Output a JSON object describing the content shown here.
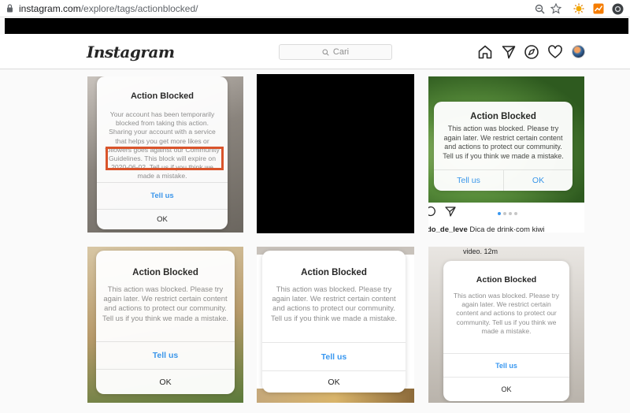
{
  "browser": {
    "url_host": "instagram.com",
    "url_path": "/explore/tags/actionblocked/"
  },
  "header": {
    "logo": "Instagram",
    "search_placeholder": "Cari"
  },
  "tiles": [
    {
      "title": "Action Blocked",
      "body": "Your account has been temporarily blocked from taking this action. Sharing your account with a service that helps you get more likes or followers goes against our Community Guidelines. This block will expire on 2020-06-02. Tell us if you think we made a mistake.",
      "primary": "Tell us",
      "secondary": "OK"
    },
    {
      "title": "Action Blocked",
      "body": "This action was blocked. Please try again later. We restrict certain content and actions to protect our community. Tell us if you think we made a mistake.",
      "primary": "Tell us",
      "secondary": "OK",
      "caption_user": "do_de_leve",
      "caption_text": "Dica de drink·com kiwi"
    },
    {
      "title": "Action Blocked",
      "body": "This action was blocked. Please try again later. We restrict certain content and actions to protect our community. Tell us if you think we made a mistake.",
      "primary": "Tell us",
      "secondary": "OK"
    },
    {
      "title": "Action Blocked",
      "body": "This action was blocked. Please try again later. We restrict certain content and actions to protect our community. Tell us if you think we made a mistake.",
      "primary": "Tell us",
      "secondary": "OK"
    },
    {
      "title": "Action Blocked",
      "body": "This action was blocked. Please try again later. We restrict certain content and actions to protect our community. Tell us if you think we made a mistake.",
      "primary": "Tell us",
      "secondary": "OK",
      "top_text": "video. 12m"
    }
  ],
  "icons": {
    "home": "home-icon",
    "direct": "paper-plane-icon",
    "explore": "compass-icon",
    "activity": "heart-icon"
  },
  "colors": {
    "link_blue": "#3897f0",
    "highlight": "#d9542b"
  }
}
